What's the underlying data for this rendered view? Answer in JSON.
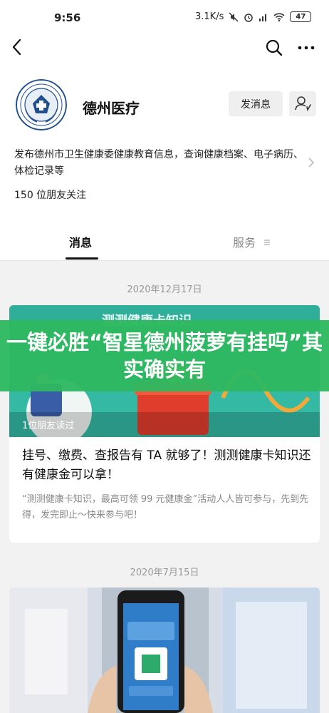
{
  "status_bar": {
    "time": "9:56",
    "speed": "3.1K/s",
    "battery": "47"
  },
  "profile": {
    "name": "德州医疗",
    "message_button": "发消息",
    "description": "发布德州市卫生健康委健康教育信息，查询健康档案、电子病历、体检记录等",
    "followers": "150 位朋友关注"
  },
  "tabs": {
    "messages": "消息",
    "services": "服务"
  },
  "feed": {
    "date1": "2020年12月17日",
    "card1": {
      "image_caption": "测测健康卡知识",
      "reads": "1位朋友读过",
      "title": "挂号、缴费、查报告有 TA 就够了！测测健康卡知识还有健康金可以拿！",
      "summary": "“测测健康卡知识，最高可领 99 元健康金”活动人人皆可参与，先到先得，发完即止～快来参与吧！"
    },
    "date2": "2020年7月15日"
  },
  "banner": {
    "text": "一键必胜“智星德州菠萝有挂吗”其实确实有"
  },
  "colors": {
    "banner_green": "#2eb860",
    "card_teal": "#34b9a4"
  }
}
